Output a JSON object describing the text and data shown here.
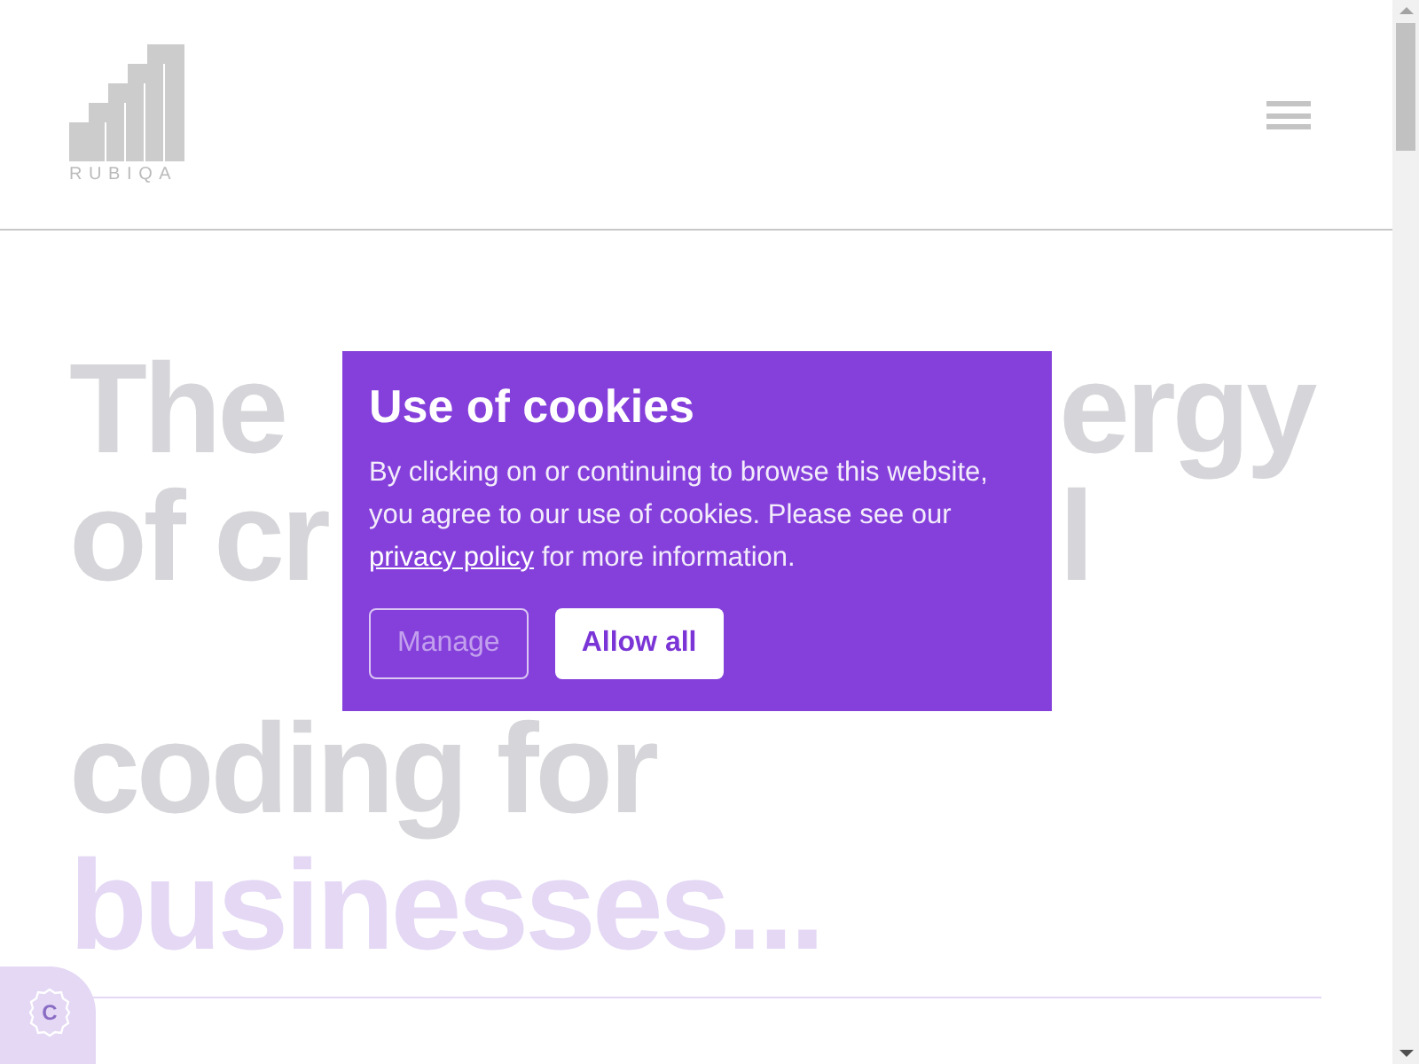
{
  "header": {
    "logo_text": "RUBIQA"
  },
  "headline": {
    "lines": [
      {
        "left": "The",
        "right": "ergy",
        "kind": "plain"
      },
      {
        "left": "of cr",
        "right": "l",
        "kind": "plain"
      },
      {
        "left": "coding for",
        "kind": "plain"
      },
      {
        "left": "businesses...",
        "kind": "accent"
      }
    ]
  },
  "cookie_dialog": {
    "title": "Use of cookies",
    "text_before": "By clicking on or continuing to browse this website, you agree to our use of cookies. Please see our",
    "link": "privacy policy",
    "text_after": "for more information.",
    "buttons": [
      {
        "label": "Manage",
        "kind": "outline"
      },
      {
        "label": "Allow all",
        "kind": "solid"
      }
    ]
  },
  "cookie_badge": {
    "letter": "C"
  }
}
